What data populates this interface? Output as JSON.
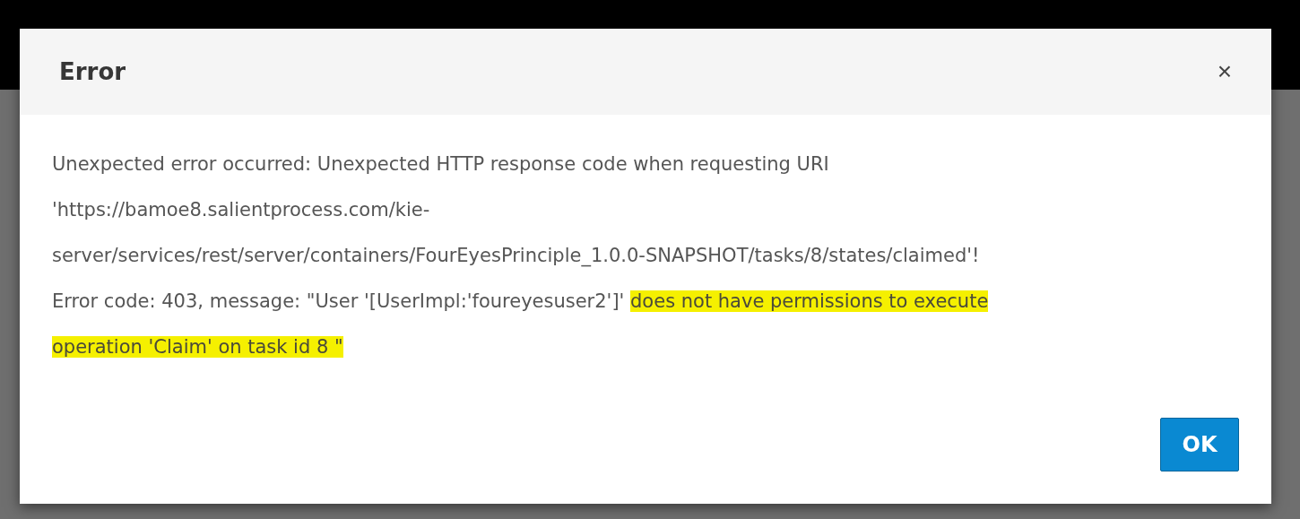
{
  "dialog": {
    "title": "Error",
    "close": "×",
    "message_lines": [
      {
        "segments": [
          {
            "text": "Unexpected error occurred: Unexpected HTTP response code when requesting URI",
            "highlighted": false
          }
        ]
      },
      {
        "segments": [
          {
            "text": "'https://bamoe8.salientprocess.com/kie-",
            "highlighted": false
          }
        ]
      },
      {
        "segments": [
          {
            "text": "server/services/rest/server/containers/FourEyesPrinciple_1.0.0-SNAPSHOT/tasks/8/states/claimed'!",
            "highlighted": false
          }
        ]
      },
      {
        "segments": [
          {
            "text": "Error code: 403, message: \"User '[UserImpl:'foureyesuser2']' ",
            "highlighted": false
          },
          {
            "text": "does not have permissions to execute",
            "highlighted": true
          }
        ]
      },
      {
        "segments": [
          {
            "text": "operation 'Claim' on task id 8 \"",
            "highlighted": true
          }
        ]
      }
    ],
    "buttons": [
      "OK"
    ]
  }
}
